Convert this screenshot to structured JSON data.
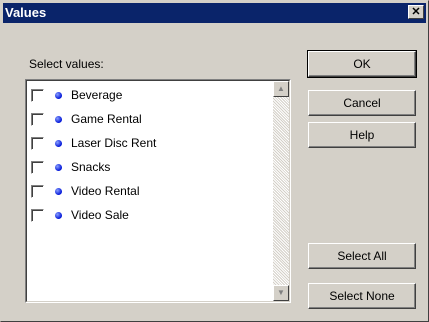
{
  "window": {
    "title": "Values",
    "close_glyph": "✕"
  },
  "label": "Select values:",
  "items": [
    {
      "label": "Beverage",
      "checked": false
    },
    {
      "label": "Game Rental",
      "checked": false
    },
    {
      "label": "Laser Disc Rent",
      "checked": false
    },
    {
      "label": "Snacks",
      "checked": false
    },
    {
      "label": "Video Rental",
      "checked": false
    },
    {
      "label": "Video Sale",
      "checked": false
    }
  ],
  "buttons": {
    "ok": "OK",
    "cancel": "Cancel",
    "help": "Help",
    "select_all": "Select All",
    "select_none": "Select None"
  },
  "scroll": {
    "up_glyph": "▲",
    "down_glyph": "▼"
  },
  "colors": {
    "titlebar": "#0a246a",
    "dot": "#0014d8",
    "face": "#d4d0c8"
  }
}
